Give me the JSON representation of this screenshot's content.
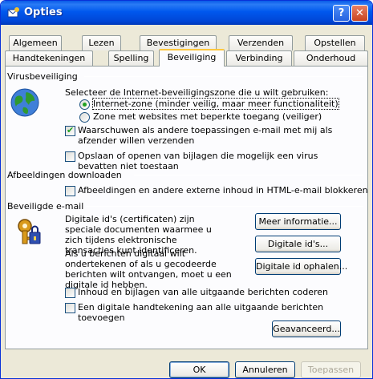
{
  "window": {
    "title": "Opties",
    "help_button": "?",
    "close_button": "✕"
  },
  "tabs_row_back": [
    "Algemeen",
    "Lezen",
    "Bevestigingen",
    "Verzenden",
    "Opstellen"
  ],
  "tabs_row_front": [
    "Handtekeningen",
    "Spelling",
    "Beveiliging",
    "Verbinding",
    "Onderhoud"
  ],
  "active_tab": "Beveiliging",
  "virus": {
    "group_label": "Virusbeveiliging",
    "instruction": "Selecteer de Internet-beveiligingszone die u wilt gebruiken:",
    "radio_internet": "Internet-zone (minder veilig, maar meer functionaliteit)",
    "radio_limited": "Zone met websites met beperkte toegang (veiliger)",
    "selected_zone": "internet",
    "warn_checkbox": "Waarschuwen als andere toepassingen e-mail met mij als afzender willen verzenden",
    "warn_checked": true,
    "block_attachments_checkbox": "Opslaan of openen van bijlagen die mogelijk een virus bevatten niet toestaan",
    "block_attachments_checked": false
  },
  "images": {
    "group_label": "Afbeeldingen downloaden",
    "block_images_checkbox": "Afbeeldingen en andere externe inhoud in HTML-e-mail blokkeren",
    "block_images_checked": false
  },
  "secure_mail": {
    "group_label": "Beveiligde e-mail",
    "desc1": "Digitale id's (certificaten) zijn speciale documenten waarmee u zich tijdens elektronische transacties kunt identificeren.",
    "desc2": "Als u berichten digitaal wilt ondertekenen of als u gecodeerde berichten wilt ontvangen, moet u een digitale id hebben.",
    "more_info_button": "Meer informatie...",
    "digital_ids_button": "Digitale id's...",
    "get_digital_id_button": "Digitale id ophalen...",
    "encrypt_checkbox": "Inhoud en bijlagen van alle uitgaande berichten coderen",
    "encrypt_checked": false,
    "sign_checkbox": "Een digitale handtekening aan alle uitgaande berichten toevoegen",
    "sign_checked": false,
    "advanced_button": "Geavanceerd..."
  },
  "footer": {
    "ok": "OK",
    "cancel": "Annuleren",
    "apply": "Toepassen"
  },
  "colors": {
    "title_blue": "#0058ee",
    "dialog_bg": "#ece9d8",
    "panel_bg": "#fcfcfe",
    "check_green": "#21a121",
    "tab_highlight": "#ffc73c"
  }
}
